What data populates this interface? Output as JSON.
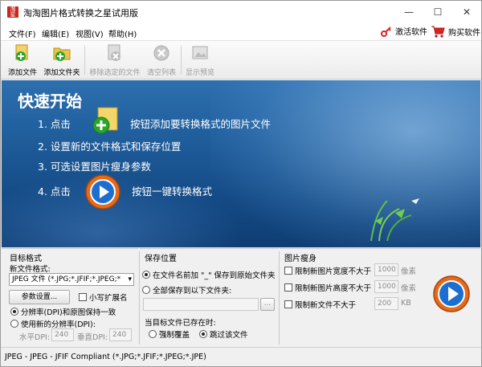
{
  "window": {
    "title": "淘淘图片格式转换之星试用版",
    "min": "—",
    "max": "☐",
    "close": "✕"
  },
  "menu": {
    "file": "文件(F)",
    "edit": "编辑(E)",
    "view": "视图(V)",
    "help": "帮助(H)",
    "activate": "激活软件",
    "buy": "购买软件"
  },
  "toolbar": {
    "add_file": "添加文件",
    "add_folder": "添加文件夹",
    "remove_selected": "移除选定的文件",
    "clear_list": "清空列表",
    "preview": "显示预览"
  },
  "quickstart": {
    "title": "快速开始",
    "step1_a": "1. 点击",
    "step1_b": "按钮添加要转换格式的图片文件",
    "step2": "2. 设置新的文件格式和保存位置",
    "step3": "3. 可选设置图片瘦身参数",
    "step4_a": "4. 点击",
    "step4_b": "按钮一键转换格式"
  },
  "target": {
    "title": "目标格式",
    "new_format_label": "新文件格式:",
    "format_value": "JPEG 文件 (*.JPG;*.JFIF;*.JPEG;*",
    "settings_btn": "参数设置...",
    "lowercase_ext": "小写扩展名",
    "dpi_keep": "分辨率(DPI)和原图保持一致",
    "dpi_new": "使用新的分辨率(DPI):",
    "h_dpi_label": "水平DPI:",
    "h_dpi": "240",
    "v_dpi_label": "垂直DPI:",
    "v_dpi": "240"
  },
  "save": {
    "title": "保存位置",
    "opt_prefix": "在文件名前加 \"_\" 保存到原始文件夹",
    "opt_all": "全部保存到以下文件夹:",
    "path": "",
    "browse": "...",
    "exists_label": "当目标文件已存在时:",
    "overwrite": "强制覆盖",
    "skip": "跳过该文件"
  },
  "slim": {
    "title": "图片瘦身",
    "width_label": "限制新图片宽度不大于",
    "width_val": "1000",
    "width_unit": "像素",
    "height_label": "限制新图片高度不大于",
    "height_val": "1000",
    "height_unit": "像素",
    "size_label": "限制新文件不大于",
    "size_val": "200",
    "size_unit": "KB"
  },
  "status": {
    "text": "JPEG - JPEG - JFIF Compliant (*.JPG;*.JFIF;*.JPEG;*.JPE)"
  },
  "colors": {
    "accent": "#1f5d9b",
    "start_orange": "#e56a1a",
    "start_blue": "#1c6fd0"
  }
}
